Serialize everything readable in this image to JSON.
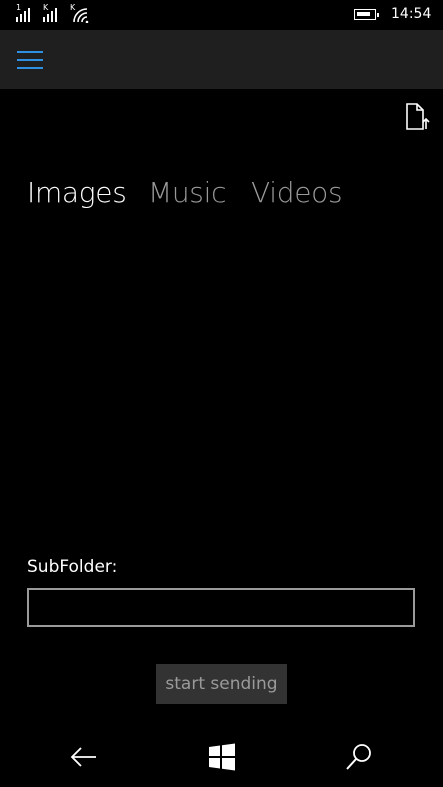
{
  "status_bar": {
    "sim1_label": "1",
    "sim2_label": "K",
    "wifi_label": "K",
    "time": "14:54",
    "icons": [
      "signal-icon",
      "signal-icon",
      "wifi-icon",
      "battery-icon"
    ]
  },
  "app_bar": {
    "menu_icon": "hamburger-icon",
    "accent_color": "#2f8fe0"
  },
  "toolbar": {
    "upload_icon": "file-upload-icon"
  },
  "pivot": {
    "tabs": [
      {
        "label": "Images",
        "selected": true
      },
      {
        "label": "Music",
        "selected": false
      },
      {
        "label": "Videos",
        "selected": false
      }
    ]
  },
  "form": {
    "subfolder_label": "SubFolder:",
    "subfolder_value": "",
    "start_button_label": "start sending"
  },
  "nav_bar": {
    "icons": [
      "back-arrow-icon",
      "windows-icon",
      "search-icon"
    ]
  }
}
